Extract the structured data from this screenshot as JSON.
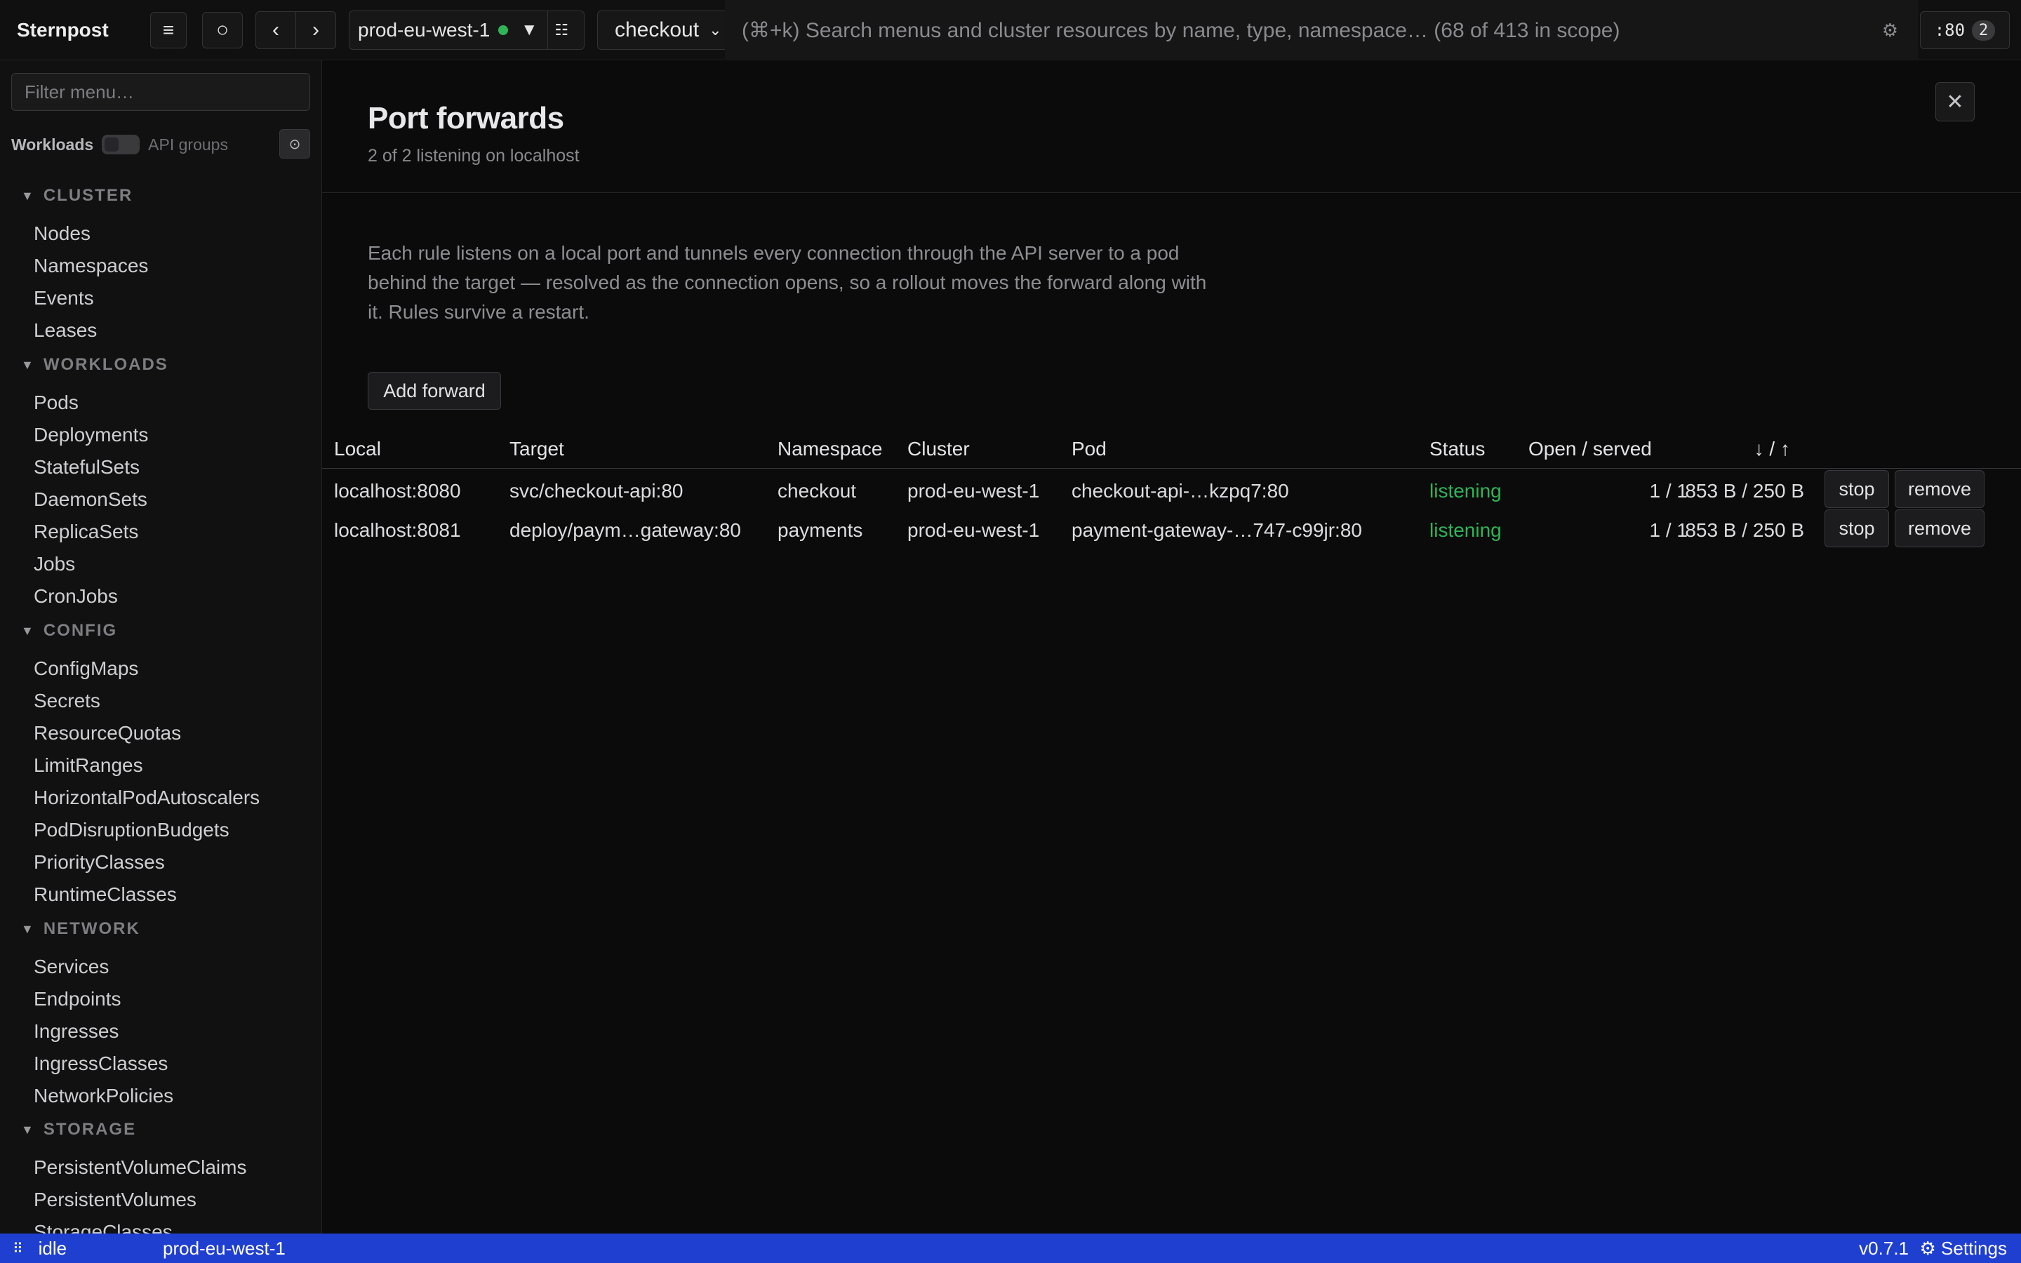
{
  "app": {
    "title": "Sternpost"
  },
  "toolbar": {
    "menu_icon": "≡",
    "circle_icon": "○",
    "back_icon": "‹",
    "forward_icon": "›",
    "context_name": "prod-eu-west-1",
    "context_caret": "▼",
    "context_grid_icon": "☷",
    "namespace": "checkout",
    "namespace_chevron": "⌄",
    "search_placeholder": "(⌘+k) Search menus and cluster resources by name, type, namespace… (68 of 413 in scope)",
    "search_gear": "⚙",
    "pf_label": ":80",
    "pf_count": "2"
  },
  "colors": {
    "accent": "#1f3fd1",
    "ok": "#2fb457"
  },
  "sidebar": {
    "filter_placeholder": "Filter menu…",
    "mode_on": "Workloads",
    "mode_off": "API groups",
    "pin_icon": "⊙",
    "sections": [
      {
        "title": "CLUSTER",
        "items": [
          "Nodes",
          "Namespaces",
          "Events",
          "Leases"
        ]
      },
      {
        "title": "WORKLOADS",
        "items": [
          "Pods",
          "Deployments",
          "StatefulSets",
          "DaemonSets",
          "ReplicaSets",
          "Jobs",
          "CronJobs"
        ]
      },
      {
        "title": "CONFIG",
        "items": [
          "ConfigMaps",
          "Secrets",
          "ResourceQuotas",
          "LimitRanges",
          "HorizontalPodAutoscalers",
          "PodDisruptionBudgets",
          "PriorityClasses",
          "RuntimeClasses"
        ]
      },
      {
        "title": "NETWORK",
        "items": [
          "Services",
          "Endpoints",
          "Ingresses",
          "IngressClasses",
          "NetworkPolicies"
        ]
      },
      {
        "title": "STORAGE",
        "items": [
          "PersistentVolumeClaims",
          "PersistentVolumes",
          "StorageClasses"
        ]
      }
    ]
  },
  "panel": {
    "title": "Port forwards",
    "subtitle": "2 of 2 listening on localhost",
    "close_icon": "✕",
    "description": "Each rule listens on a local port and tunnels every connection through the API server to a pod behind the target — resolved as the connection opens, so a rollout moves the forward along with it. Rules survive a restart.",
    "add_button": "Add forward",
    "columns": {
      "local": "Local",
      "target": "Target",
      "namespace": "Namespace",
      "cluster": "Cluster",
      "pod": "Pod",
      "status": "Status",
      "open_served": "Open / served",
      "traffic": "↓ / ↑"
    },
    "rows": [
      {
        "local": "localhost:8080",
        "target": "svc/checkout-api:80",
        "namespace": "checkout",
        "cluster": "prod-eu-west-1",
        "pod": "checkout-api-…kzpq7:80",
        "status": "listening",
        "open_served": "1 / 1",
        "traffic": "853 B / 250 B",
        "stop": "stop",
        "remove": "remove"
      },
      {
        "local": "localhost:8081",
        "target": "deploy/paym…gateway:80",
        "namespace": "payments",
        "cluster": "prod-eu-west-1",
        "pod": "payment-gateway-…747-c99jr:80",
        "status": "listening",
        "open_served": "1 / 1",
        "traffic": "853 B / 250 B",
        "stop": "stop",
        "remove": "remove"
      }
    ]
  },
  "statusbar": {
    "grip": "⠿",
    "state": "idle",
    "cluster": "prod-eu-west-1",
    "version": "v0.7.1",
    "settings": "⚙ Settings"
  }
}
